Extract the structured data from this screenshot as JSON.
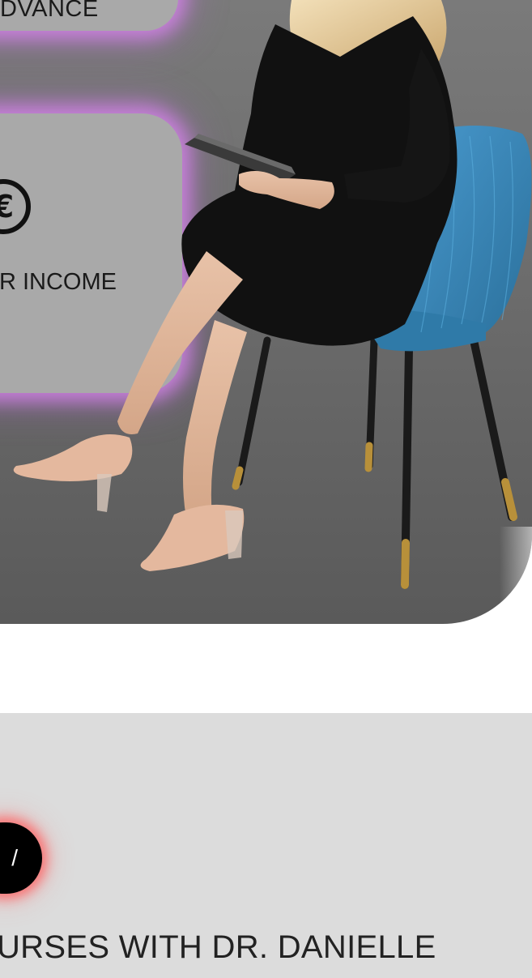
{
  "cards": {
    "top_label": "DVANCE",
    "main_label": "UR INCOME",
    "main_icon": "euro-icon",
    "main_icon_glyph": "€"
  },
  "cta": {
    "label": "/",
    "color": "#000000",
    "glow_color": "#ff5a5a"
  },
  "courses": {
    "text": "URSES WITH DR. DANIELLE"
  },
  "colors": {
    "card_glow": "#d282e6",
    "card_bg": "#a9a9a9",
    "chair": "#3a8ab8",
    "dress": "#111111",
    "lower_bg": "#dcdcdc"
  }
}
